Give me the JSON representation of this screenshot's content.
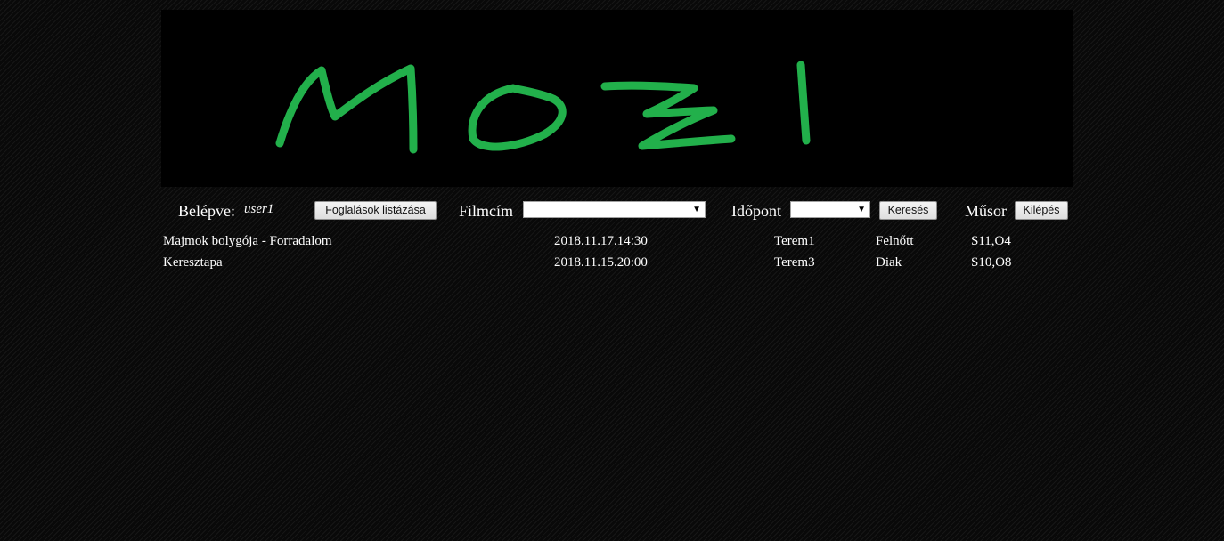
{
  "banner": {
    "logo_text": "MOZI",
    "logo_color": "#22b04b",
    "background": "#000000"
  },
  "toolbar": {
    "logged_in_label": "Belépve:",
    "username": "user1",
    "list_bookings_button": "Foglalások listázása",
    "film_title_label": "Filmcím",
    "film_title_value": "",
    "time_label": "Időpont",
    "time_value": "",
    "search_button": "Keresés",
    "program_label": "Műsor",
    "logout_button": "Kilépés"
  },
  "bookings": [
    {
      "title": "Majmok bolygója - Forradalom",
      "datetime": "2018.11.17.14:30",
      "room": "Terem1",
      "ticket_type": "Felnőtt",
      "seats": "S11,O4"
    },
    {
      "title": "Keresztapa",
      "datetime": "2018.11.15.20:00",
      "room": "Terem3",
      "ticket_type": "Diak",
      "seats": "S10,O8"
    }
  ]
}
